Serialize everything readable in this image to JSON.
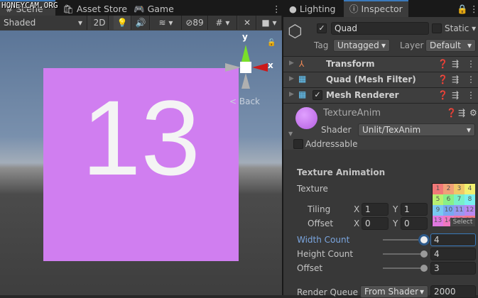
{
  "watermark": "HONEYCAM.ORG",
  "scene_tabs": [
    {
      "label": "Scene",
      "icon": "hash-icon"
    },
    {
      "label": "Asset Store",
      "icon": "bag-icon"
    },
    {
      "label": "Game",
      "icon": "gamepad-icon"
    }
  ],
  "scene_toolbar": {
    "shading": "Shaded",
    "mode_2d": "2D",
    "hidden_count": "89"
  },
  "scene": {
    "quad_text": "13",
    "gizmo_y": "y",
    "gizmo_x": "x",
    "back_label": "Back",
    "quad_color": "#d07ef0"
  },
  "inspector_tabs": [
    {
      "label": "Lighting"
    },
    {
      "label": "Inspector"
    }
  ],
  "object": {
    "name": "Quad",
    "active": true,
    "static_label": "Static",
    "tag_label": "Tag",
    "tag": "Untagged",
    "layer_label": "Layer",
    "layer": "Default"
  },
  "components": [
    {
      "name": "Transform"
    },
    {
      "name": "Quad (Mesh Filter)"
    },
    {
      "name": "Mesh Renderer",
      "enabled": true
    }
  ],
  "material": {
    "name": "TextureAnim",
    "shader_label": "Shader",
    "shader": "Unlit/TexAnim",
    "addressable": "Addressable"
  },
  "texture_animation": {
    "title": "Texture Animation",
    "texture_label": "Texture",
    "tiling_label": "Tiling",
    "offset_label": "Offset",
    "x": "X",
    "y": "Y",
    "tiling_x": "1",
    "tiling_y": "1",
    "offset_x": "0",
    "offset_y": "0",
    "select": "Select",
    "thumb_cells": [
      "1",
      "2",
      "3",
      "4",
      "5",
      "6",
      "7",
      "8",
      "9",
      "10",
      "11",
      "12",
      "13",
      "14",
      "15",
      "16"
    ],
    "thumb_colors": [
      "#f07878",
      "#f0a078",
      "#f0c868",
      "#f0f070",
      "#b8f070",
      "#88f088",
      "#78f0c8",
      "#78f0f0",
      "#78c8f0",
      "#78a8f0",
      "#9898f0",
      "#b888f0",
      "#e078e0",
      "#f078c0",
      "#f078a0",
      "#f07888"
    ],
    "width_count_label": "Width Count",
    "width_count": "4",
    "height_count_label": "Height Count",
    "height_count": "4",
    "offset2_label": "Offset",
    "offset2": "3",
    "render_queue_label": "Render Queue",
    "render_queue_mode": "From Shader",
    "render_queue": "2000"
  }
}
